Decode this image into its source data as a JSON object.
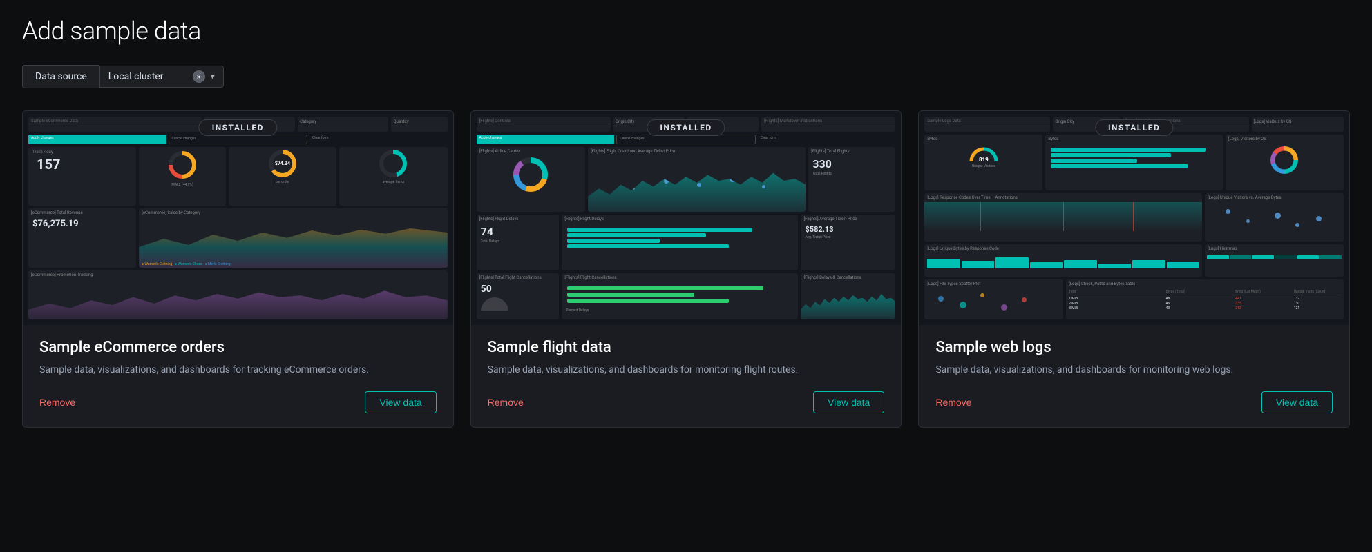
{
  "page": {
    "title": "Add sample data",
    "toolbar": {
      "tab_label": "Data source",
      "cluster_label": "Local cluster",
      "clear_icon": "×",
      "chevron_icon": "▾"
    },
    "cards": [
      {
        "id": "ecommerce",
        "installed_badge": "INSTALLED",
        "title": "Sample eCommerce orders",
        "description": "Sample data, visualizations, and dashboards for tracking eCommerce orders.",
        "remove_label": "Remove",
        "view_label": "View data",
        "preview": {
          "big_number": "157",
          "big_number_label": "Trxns / day",
          "price": "$74.34",
          "price_label": "per order",
          "items_label": "average Items",
          "revenue": "$76,275.19"
        }
      },
      {
        "id": "flights",
        "installed_badge": "INSTALLED",
        "title": "Sample flight data",
        "description": "Sample data, visualizations, and dashboards for monitoring flight routes.",
        "remove_label": "Remove",
        "view_label": "View data",
        "preview": {
          "flights_count": "330",
          "flights_label": "Total Flights",
          "ticket_price": "$582.13",
          "ticket_label": "Avg. Ticket Price",
          "delays": "74",
          "delays_label": "Total Delays",
          "cancellations": "50"
        }
      },
      {
        "id": "weblogs",
        "installed_badge": "INSTALLED",
        "title": "Sample web logs",
        "description": "Sample data, visualizations, and dashboards for monitoring web logs.",
        "remove_label": "Remove",
        "view_label": "View data",
        "preview": {
          "visitors": "819",
          "visitors_label": "Unique Visitors"
        }
      }
    ]
  }
}
